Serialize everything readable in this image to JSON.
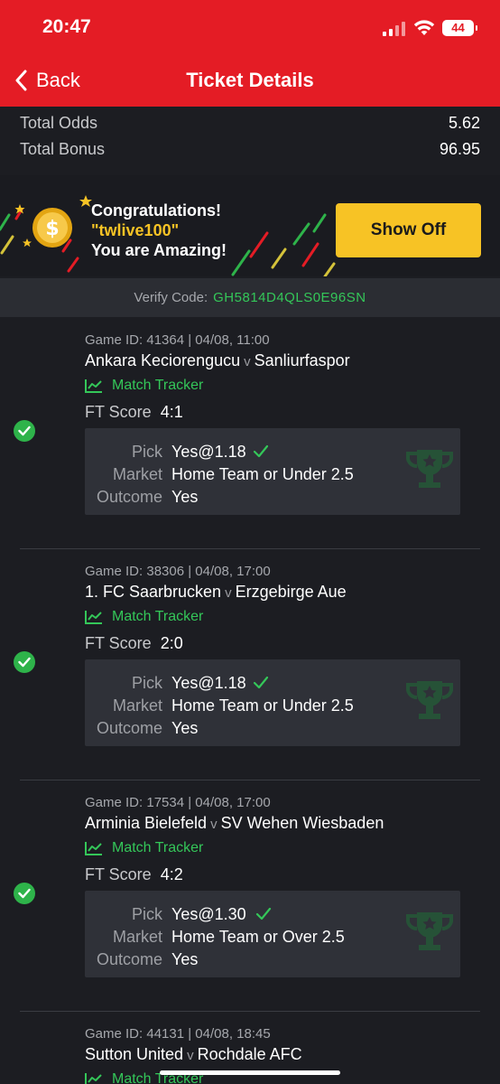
{
  "status_bar": {
    "time": "20:47",
    "battery": "44"
  },
  "nav": {
    "back_label": "Back",
    "title": "Ticket Details"
  },
  "totals": [
    {
      "label": "Total Odds",
      "value": "5.62"
    },
    {
      "label": "Total Bonus",
      "value": "96.95"
    }
  ],
  "banner": {
    "line1": "Congratulations!",
    "username": "\"twlive100\"",
    "line3": "You are Amazing!",
    "button_label": "Show Off"
  },
  "verify": {
    "label": "Verify Code:",
    "code": "GH5814D4QLS0E96SN"
  },
  "games": [
    {
      "id_line": "Game ID: 41364 | 04/08, 11:00",
      "home": "Ankara Keciorengucu",
      "vs": "v",
      "away": "Sanliurfaspor",
      "tracker": "Match Tracker",
      "ft_label": "FT Score",
      "ft_value": "4:1",
      "pick_label": "Pick",
      "pick_value": "Yes@1.18",
      "market_label": "Market",
      "market_value": "Home Team or Under 2.5",
      "outcome_label": "Outcome",
      "outcome_value": "Yes"
    },
    {
      "id_line": "Game ID: 38306 | 04/08, 17:00",
      "home": "1. FC Saarbrucken",
      "vs": "v",
      "away": "Erzgebirge Aue",
      "tracker": "Match Tracker",
      "ft_label": "FT Score",
      "ft_value": "2:0",
      "pick_label": "Pick",
      "pick_value": "Yes@1.18",
      "market_label": "Market",
      "market_value": "Home Team or Under 2.5",
      "outcome_label": "Outcome",
      "outcome_value": "Yes"
    },
    {
      "id_line": "Game ID: 17534 | 04/08, 17:00",
      "home": "Arminia Bielefeld",
      "vs": "v",
      "away": "SV Wehen Wiesbaden",
      "tracker": "Match Tracker",
      "ft_label": "FT Score",
      "ft_value": "4:2",
      "pick_label": "Pick",
      "pick_value": "Yes@1.30",
      "market_label": "Market",
      "market_value": "Home Team or Over 2.5",
      "outcome_label": "Outcome",
      "outcome_value": "Yes"
    },
    {
      "id_line": "Game ID: 44131 | 04/08, 18:45",
      "home": "Sutton United",
      "vs": "v",
      "away": "Rochdale AFC",
      "tracker": "Match Tracker"
    }
  ],
  "colors": {
    "brand_red": "#e41c25",
    "win_green": "#2eb34a",
    "accent_yellow": "#f7c325",
    "background": "#1c1d22"
  },
  "icons": [
    "back-chevron-icon",
    "coin-icon",
    "check-circle-icon",
    "chart-line-icon",
    "checkmark-icon",
    "trophy-icon",
    "signal-icon",
    "wifi-icon",
    "battery-icon"
  ]
}
